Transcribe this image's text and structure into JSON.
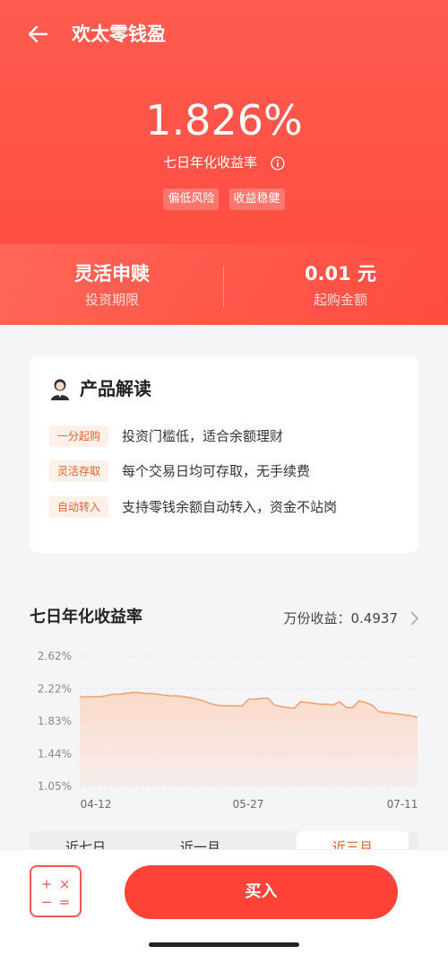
{
  "header": {
    "title": "欢太零钱盈"
  },
  "hero": {
    "rate": "1.826%",
    "rate_label": "七日年化收益率",
    "tags": [
      "偏低风险",
      "收益稳健"
    ]
  },
  "stats": [
    {
      "value": "灵活申赎",
      "label": "投资期限"
    },
    {
      "value": "0.01 元",
      "label": "起购金额"
    }
  ],
  "product": {
    "title": "产品解读",
    "features": [
      {
        "badge": "一分起购",
        "text": "投资门槛低，适合余额理财"
      },
      {
        "badge": "灵活存取",
        "text": "每个交易日均可存取，无手续费"
      },
      {
        "badge": "自动转入",
        "text": "支持零钱余额自动转入，资金不站岗"
      }
    ]
  },
  "chart_section": {
    "title": "七日年化收益率",
    "unit_label": "万份收益：0.4937"
  },
  "chart_data": {
    "type": "area",
    "y_ticks": [
      "2.62%",
      "2.22%",
      "1.83%",
      "1.44%",
      "1.05%"
    ],
    "ylim": [
      1.05,
      2.62
    ],
    "x_ticks": [
      "04-12",
      "05-27",
      "07-11"
    ],
    "grid": true,
    "colors": {
      "line": "#f0a276",
      "fill": "#fbd9c7"
    },
    "series": [
      {
        "values": [
          2.13,
          2.13,
          2.13,
          2.13,
          2.14,
          2.16,
          2.16,
          2.17,
          2.18,
          2.18,
          2.17,
          2.17,
          2.16,
          2.15,
          2.14,
          2.14,
          2.13,
          2.12,
          2.1,
          2.08,
          2.05,
          2.03,
          2.02,
          2.02,
          2.02,
          2.02,
          2.1,
          2.1,
          2.11,
          2.11,
          2.03,
          2.01,
          2.0,
          1.99,
          2.07,
          2.06,
          2.05,
          2.04,
          2.04,
          2.03,
          2.07,
          2.0,
          2.0,
          2.08,
          2.06,
          2.03,
          1.95,
          1.94,
          1.93,
          1.92,
          1.91,
          1.9,
          1.88
        ]
      }
    ]
  },
  "tabs": [
    "近七日",
    "近一月",
    "近三月"
  ],
  "bottom": {
    "calc_symbols": [
      "+",
      "×",
      "−",
      "="
    ],
    "buy_label": "买入"
  }
}
